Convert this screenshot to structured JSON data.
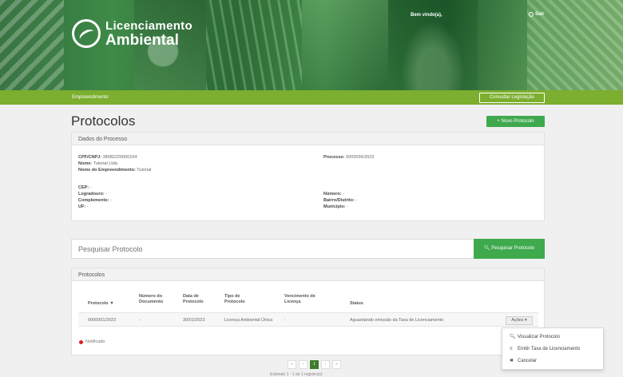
{
  "header": {
    "logo_line1": "Licenciamento",
    "logo_line2": "Ambiental",
    "welcome": "Bem vindo(a),",
    "logout_label": "Sair"
  },
  "nav": {
    "item": "Empreendimento",
    "legislation_button": "Consultar Legislação"
  },
  "page": {
    "title": "Protocolos",
    "new_button": "+ Novo Protocolo"
  },
  "dados": {
    "heading": "Dados do Processo",
    "cpf_label": "CPF/CNPJ:",
    "cpf_value": "38082220000154",
    "nome_label": "Nome:",
    "nome_value": "Tutorial Ltda",
    "empreend_label": "Nome do Empreendimento:",
    "empreend_value": "Tutorial",
    "processo_label": "Processo:",
    "processo_value": "0000036/2023",
    "cep_label": "CEP:",
    "cep_value": "-",
    "logradouro_label": "Logradouro:",
    "logradouro_value": "-",
    "complemento_label": "Complemento:",
    "complemento_value": "-",
    "uf_label": "UF:",
    "uf_value": "-",
    "numero_label": "Número:",
    "numero_value": "-",
    "bairro_label": "Bairro/Distrito:",
    "bairro_value": "-",
    "municipio_label": "Município:",
    "municipio_value": "-"
  },
  "search": {
    "placeholder": "Pesquisar Protocolo",
    "button": "Pesquisar Protocolo"
  },
  "protocolos": {
    "heading": "Protocolos",
    "columns": [
      "Protocolo ▼",
      "Número do Documento",
      "Data de Protocolo",
      "Tipo de Protocolo",
      "Vencimento de Licença",
      "Status"
    ],
    "rows": [
      {
        "protocolo": "0000001/2023",
        "numero": "-",
        "data": "30/01/2023",
        "tipo": "Licença Ambiental Única",
        "vencimento": "-",
        "status": "Aguardando emissão da Taxa de Licenciamento",
        "acoes": "Ações ▾"
      }
    ],
    "legend": "Notificado"
  },
  "dropdown": {
    "items": [
      "Visualizar Protocolo",
      "Emitir Taxa de Licenciamento",
      "Cancelar"
    ]
  },
  "pagination": {
    "first": "«",
    "prev": "‹",
    "current": "1",
    "next": "›",
    "last": "»",
    "info": "Exibindo 1 - 1 de 1 registro(s)"
  },
  "colors": {
    "accent_green": "#3fa94d",
    "nav_green": "#7cae2f",
    "notified_red": "#e02020"
  }
}
